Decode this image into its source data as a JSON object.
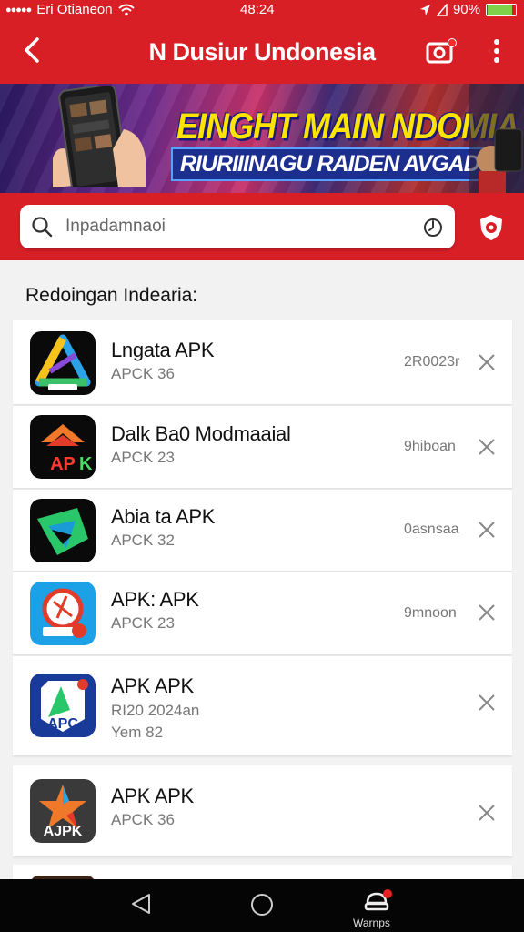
{
  "status_bar": {
    "carrier": "Eri Otianeon",
    "time": "48:24",
    "battery": "90%",
    "battery_level": 0.9
  },
  "app_bar": {
    "title": "N Dusiur Undonesia",
    "icons": [
      "back-arrow-icon",
      "camera-icon",
      "more-vertical-icon"
    ]
  },
  "banner": {
    "headline": "EINGHT MAIN NDOMIA",
    "subtitle": "RIURIIINAGU RAIDEN AVGADS"
  },
  "search": {
    "placeholder": "Inpadamnaoi"
  },
  "section_title": "Redoingan Indearia:",
  "apps": [
    {
      "name": "Lngata APK",
      "version": "APCK 36",
      "size": "2R0023r",
      "icon": "app-icon-a-triangle"
    },
    {
      "name": "Dalk Ba0 Modmaaial",
      "version": "APCK 23",
      "size": "9hiboan",
      "icon": "app-icon-apk-orange"
    },
    {
      "name": "Abia ta APK",
      "version": "APCK 32",
      "size": "0asnsaa",
      "icon": "app-icon-green-arrow"
    },
    {
      "name": "APK: APK",
      "version": "APCK 23",
      "size": "9mnoon",
      "icon": "app-icon-red-circle"
    },
    {
      "name": "APK APK",
      "version": "RI20 2024an",
      "line3": "Yem 82",
      "icon": "app-icon-apc-blue"
    },
    {
      "name": "APK APK",
      "version": "APCK 36",
      "icon": "app-icon-ajpk-star"
    }
  ],
  "nav_bar": {
    "warn_label": "Warnps",
    "icons": [
      "nav-back-icon",
      "nav-home-icon",
      "nav-warning-icon"
    ]
  },
  "colors": {
    "brand_red": "#d91f26",
    "banner_yellow": "#ffe400"
  }
}
